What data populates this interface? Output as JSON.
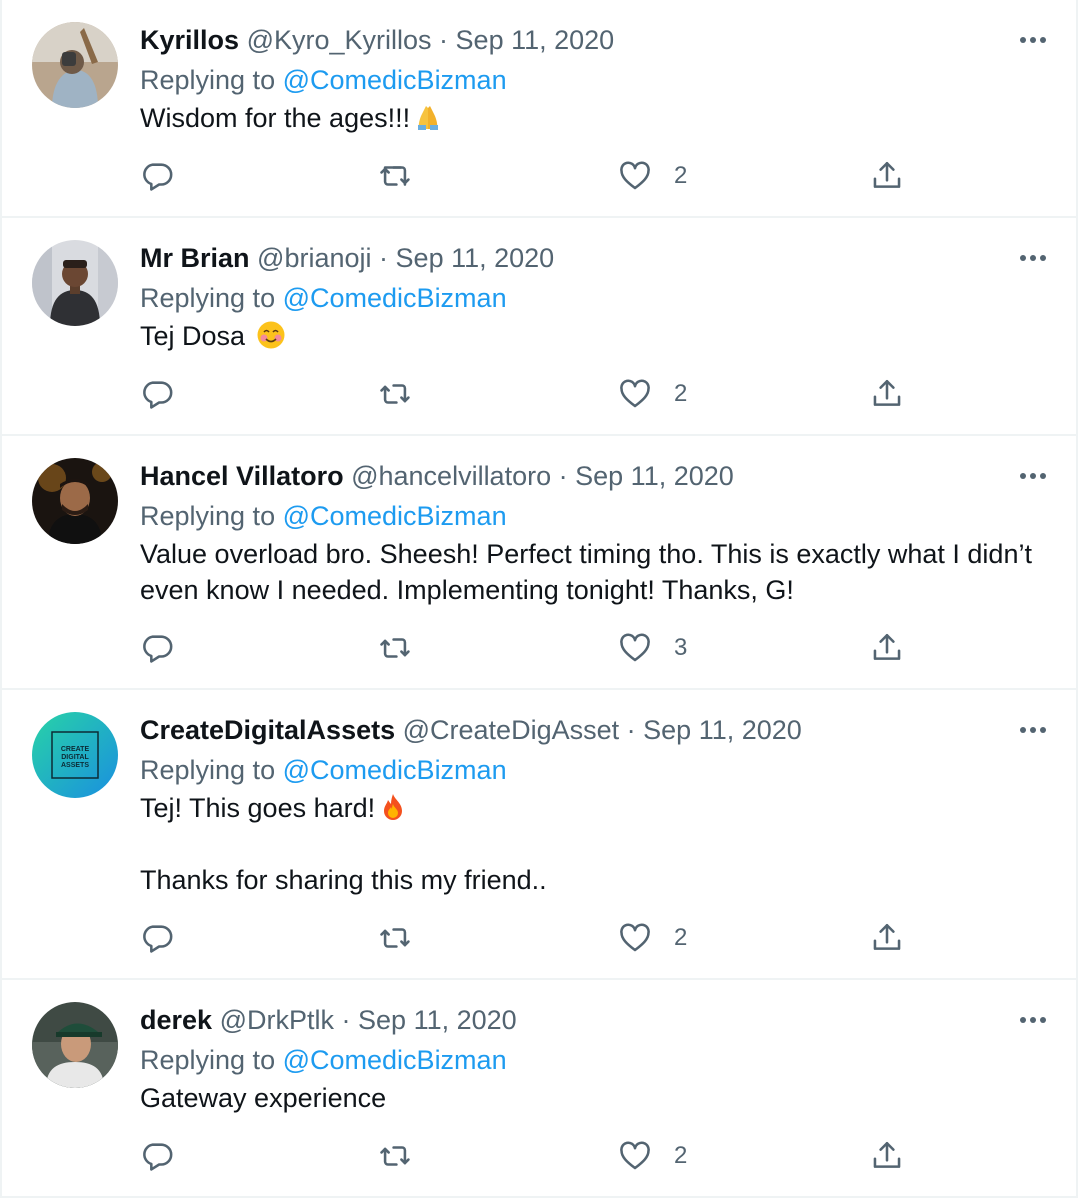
{
  "replying_label": "Replying to",
  "replies": [
    {
      "name": "Kyrillos",
      "handle": "@Kyro_Kyrillos",
      "separator": "·",
      "date": "Sep 11, 2020",
      "replying_to": "@ComedicBizman",
      "text": [
        "Wisdom for the ages!!!"
      ],
      "emoji": "folded-hands",
      "likes": "2"
    },
    {
      "name": "Mr Brian",
      "handle": "@brianoji",
      "separator": "·",
      "date": "Sep 11, 2020",
      "replying_to": "@ComedicBizman",
      "text": [
        "Tej Dosa "
      ],
      "emoji": "smiling-face-with-blush",
      "likes": "2"
    },
    {
      "name": "Hancel Villatoro",
      "handle": "@hancelvillatoro",
      "separator": "·",
      "date": "Sep 11, 2020",
      "replying_to": "@ComedicBizman",
      "text": [
        "Value overload bro. Sheesh! Perfect timing tho. This is exactly what I didn’t even know I needed. Implementing tonight! Thanks, G!"
      ],
      "likes": "3"
    },
    {
      "name": "CreateDigitalAssets",
      "handle": "@CreateDigAsset",
      "separator": "·",
      "date": "Sep 11, 2020",
      "replying_to": "@ComedicBizman",
      "text": [
        "Tej! This goes hard!",
        "Thanks for sharing this my friend.."
      ],
      "emoji": "fire",
      "avatar_text": [
        "CREATE",
        "DIGITAL",
        "ASSETS"
      ],
      "likes": "2"
    },
    {
      "name": "derek",
      "handle": "@DrkPtlk",
      "separator": "·",
      "date": "Sep 11, 2020",
      "replying_to": "@ComedicBizman",
      "text": [
        "Gateway experience"
      ],
      "likes": "2"
    }
  ],
  "icons": {
    "reply": "reply-bubble-icon",
    "retweet": "retweet-icon",
    "like": "heart-icon",
    "share": "share-icon",
    "more": "more-options-icon"
  },
  "colors": {
    "text": "#0f1419",
    "secondary": "#536471",
    "link": "#1d9bf0",
    "border": "#eff3f4"
  }
}
